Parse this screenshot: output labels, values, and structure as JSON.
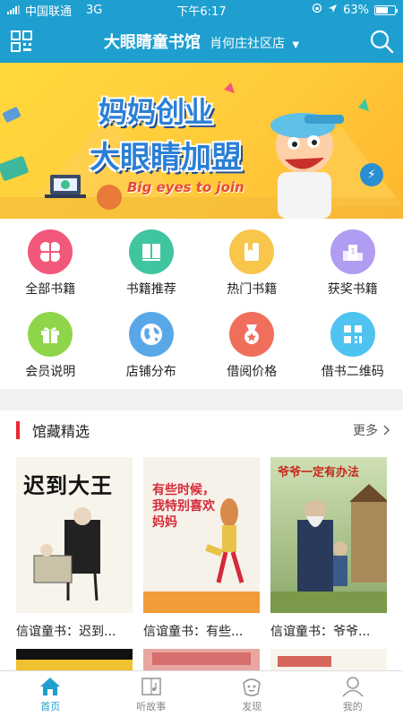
{
  "status": {
    "carrier": "中国联通",
    "network": "3G",
    "time": "下午6:17",
    "battery": "63%",
    "battery_level": 0.63
  },
  "nav": {
    "title": "大眼睛童书馆",
    "store": "肖何庄社区店"
  },
  "banner": {
    "line1": "妈妈创业",
    "line2": "大眼睛加盟",
    "subtitle": "Big eyes to join"
  },
  "menu": [
    {
      "label": "全部书籍",
      "icon": "clover-icon",
      "color": "#f2587a"
    },
    {
      "label": "书籍推荐",
      "icon": "book-icon",
      "color": "#3fc6a0"
    },
    {
      "label": "热门书籍",
      "icon": "bookmark-icon",
      "color": "#f7c64a"
    },
    {
      "label": "获奖书籍",
      "icon": "podium-icon",
      "color": "#b09cf0"
    },
    {
      "label": "会员说明",
      "icon": "gift-icon",
      "color": "#8fd54a"
    },
    {
      "label": "店铺分布",
      "icon": "globe-icon",
      "color": "#5aa7e8"
    },
    {
      "label": "借阅价格",
      "icon": "medal-icon",
      "color": "#f06e5c"
    },
    {
      "label": "借书二维码",
      "icon": "qrcode-icon",
      "color": "#4fc3f0"
    }
  ],
  "section": {
    "title": "馆藏精选",
    "more": "更多"
  },
  "books": [
    {
      "title": "信谊童书：迟到...",
      "cover_title": "迟到大王"
    },
    {
      "title": "信谊童书：有些...",
      "cover_title": "有些时候，我特别喜欢妈妈"
    },
    {
      "title": "信谊童书：爷爷...",
      "cover_title": "爷爷一定有办法"
    }
  ],
  "tabs": [
    {
      "label": "首页",
      "icon": "home-icon"
    },
    {
      "label": "听故事",
      "icon": "music-book-icon"
    },
    {
      "label": "发现",
      "icon": "discover-icon"
    },
    {
      "label": "我的",
      "icon": "user-icon"
    }
  ],
  "colors": {
    "brand": "#1e9fd0",
    "section_bar": "#e8272e"
  }
}
